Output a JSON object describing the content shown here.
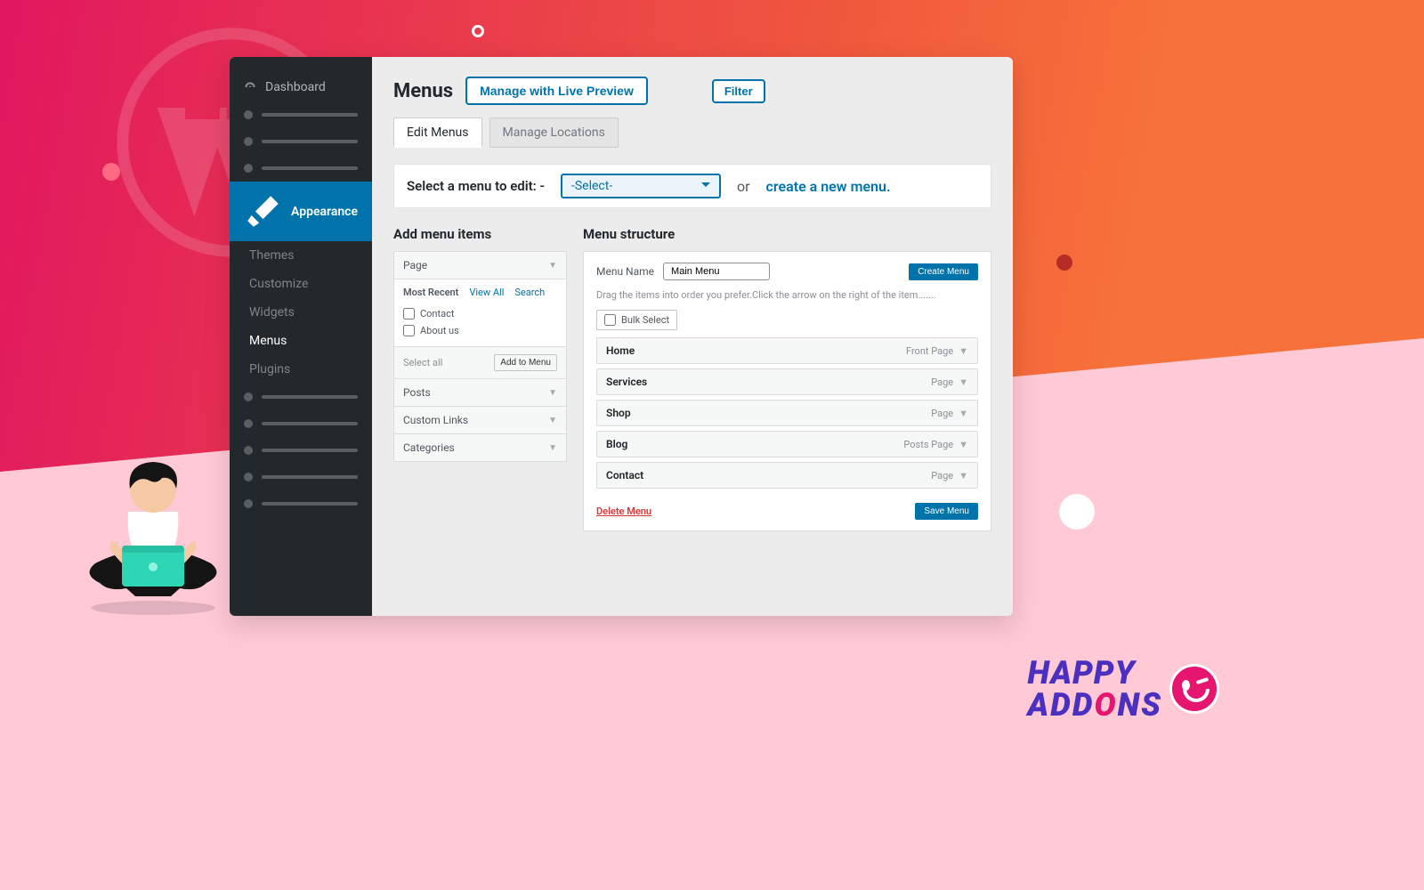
{
  "sidebar": {
    "dashboard": "Dashboard",
    "appearance": "Appearance",
    "subs": {
      "themes": "Themes",
      "customize": "Customize",
      "widgets": "Widgets",
      "menus": "Menus",
      "plugins": "Plugins"
    }
  },
  "head": {
    "title": "Menus",
    "live_preview": "Manage with Live Preview",
    "filter": "Filter"
  },
  "tabs": {
    "edit": "Edit Menus",
    "locations": "Manage Locations"
  },
  "selectbar": {
    "label": "Select a menu to edit: -",
    "select_value": "-Select-",
    "or": "or",
    "create": "create a new menu."
  },
  "left": {
    "heading": "Add menu items",
    "panel_page": "Page",
    "panel_posts": "Posts",
    "panel_custom": "Custom Links",
    "panel_categories": "Categories",
    "mini_recent": "Most Recent",
    "mini_all": "View All",
    "mini_search": "Search",
    "item_contact": "Contact",
    "item_about": "About us",
    "select_all": "Select all",
    "add_to_menu": "Add to Menu"
  },
  "right": {
    "heading": "Menu structure",
    "name_label": "Menu Name",
    "name_value": "Main Menu",
    "create_btn": "Create Menu",
    "help": "Drag the items into order  you prefer.Click the arrow on the right of the item.......",
    "bulk": "Bulk Select",
    "items": [
      {
        "title": "Home",
        "type": "Front Page"
      },
      {
        "title": "Services",
        "type": "Page"
      },
      {
        "title": "Shop",
        "type": "Page"
      },
      {
        "title": "Blog",
        "type": "Posts Page"
      },
      {
        "title": "Contact",
        "type": "Page"
      }
    ],
    "delete": "Delete Menu",
    "save": "Save Menu"
  },
  "brand": {
    "line1": "HAPPY",
    "line2_a": "ADD",
    "line2_b": "NS"
  }
}
